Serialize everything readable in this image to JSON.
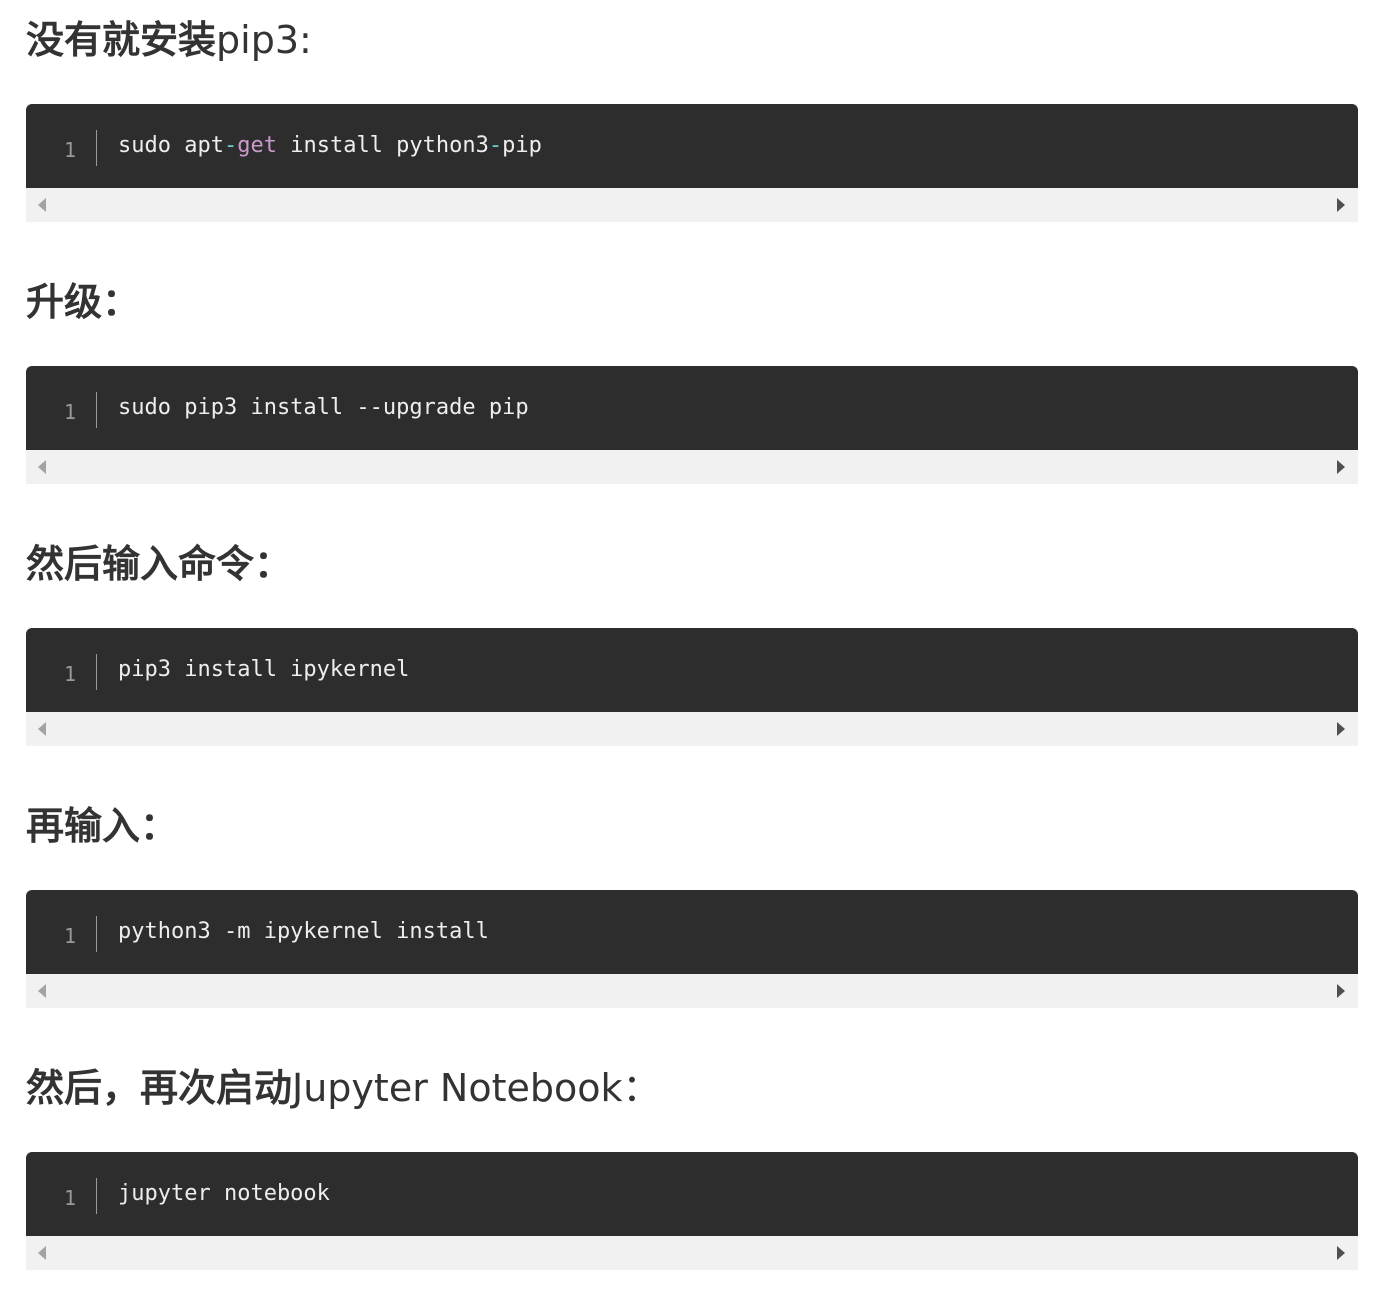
{
  "sections": [
    {
      "heading_strong": "没有就安装",
      "heading_rest": "pip3:",
      "line_number": "1",
      "code": [
        {
          "text": "sudo apt",
          "kind": "plain"
        },
        {
          "text": "-",
          "kind": "op"
        },
        {
          "text": "get",
          "kind": "kw"
        },
        {
          "text": " install python3",
          "kind": "plain"
        },
        {
          "text": "-",
          "kind": "op"
        },
        {
          "text": "pip",
          "kind": "plain"
        }
      ]
    },
    {
      "heading_strong": "升级：",
      "heading_rest": "",
      "line_number": "1",
      "code": [
        {
          "text": "sudo pip3 install --upgrade pip",
          "kind": "plain"
        }
      ]
    },
    {
      "heading_strong": "然后输入命令：",
      "heading_rest": "",
      "line_number": "1",
      "code": [
        {
          "text": "pip3 install ipykernel",
          "kind": "plain"
        }
      ]
    },
    {
      "heading_strong": "再输入：",
      "heading_rest": "",
      "line_number": "1",
      "code": [
        {
          "text": "python3 -m ipykernel install",
          "kind": "plain"
        }
      ]
    },
    {
      "heading_strong": "然后，再次启动",
      "heading_rest": "Jupyter Notebook：",
      "line_number": "1",
      "code": [
        {
          "text": "jupyter notebook",
          "kind": "plain"
        }
      ]
    }
  ],
  "colors": {
    "code_background": "#2d2d2d",
    "code_text": "#eeeeee",
    "operator": "#67cdcc",
    "keyword": "#cc99cd",
    "line_number": "#999999",
    "scrollbar_track": "#f1f1f1"
  }
}
